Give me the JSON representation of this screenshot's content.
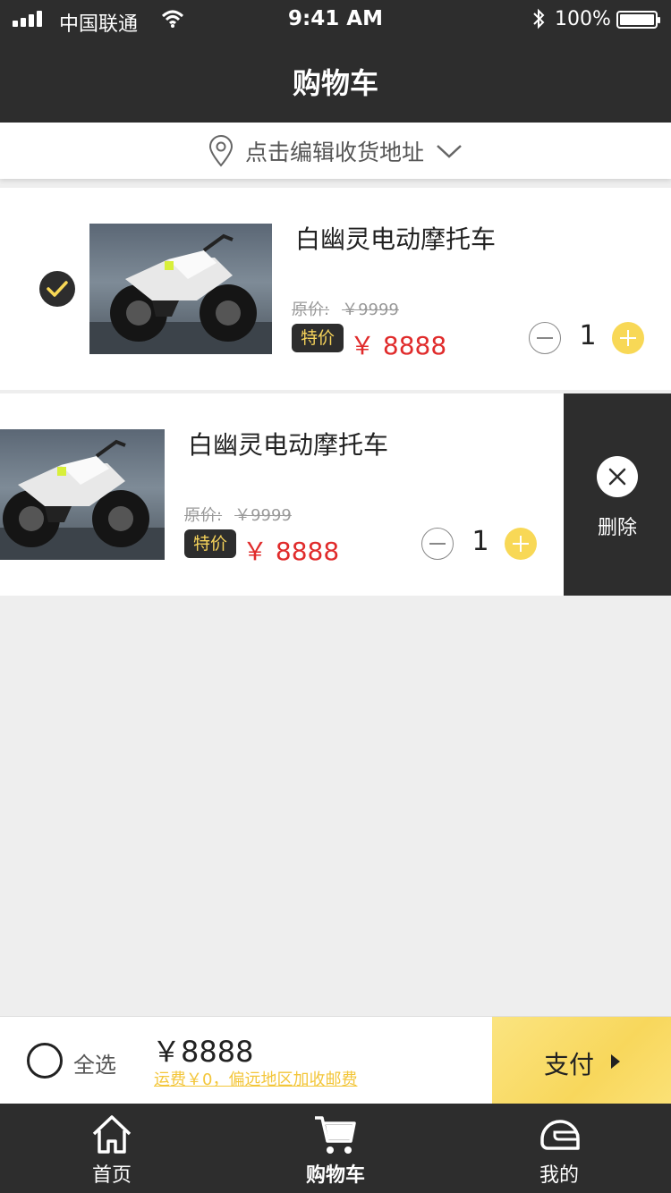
{
  "status_bar": {
    "carrier": "中国联通",
    "time": "9:41 AM",
    "battery": "100%",
    "icons": [
      "signal-icon",
      "wifi-icon",
      "bluetooth-icon",
      "battery-icon"
    ]
  },
  "nav": {
    "title": "购物车"
  },
  "address": {
    "text": "点击编辑收货地址",
    "icon": "location-pin-icon",
    "chevron": "chevron-down-icon"
  },
  "cart_items": [
    {
      "name": "白幽灵电动摩托车",
      "original_label": "原价:",
      "original_price": "￥9999",
      "tag": "特价",
      "price": "￥ 8888",
      "quantity": "1",
      "checked": true
    },
    {
      "name": "白幽灵电动摩托车",
      "original_label": "原价:",
      "original_price": "￥9999",
      "tag": "特价",
      "price": "￥ 8888",
      "quantity": "1",
      "swiped": true
    }
  ],
  "delete_action": {
    "label": "删除",
    "icon": "close-icon"
  },
  "checkout": {
    "select_all": "全选",
    "total": "￥8888",
    "shipping": "运费￥0，偏远地区加收邮费",
    "pay": "支付"
  },
  "tabbar": {
    "items": [
      {
        "label": "首页",
        "icon": "home-icon"
      },
      {
        "label": "购物车",
        "icon": "cart-icon",
        "active": true
      },
      {
        "label": "我的",
        "icon": "helmet-icon"
      }
    ]
  },
  "colors": {
    "dark": "#2d2d2d",
    "accent_yellow": "#f8d856",
    "price_red": "#e02b2b",
    "background": "#eeeeee"
  }
}
